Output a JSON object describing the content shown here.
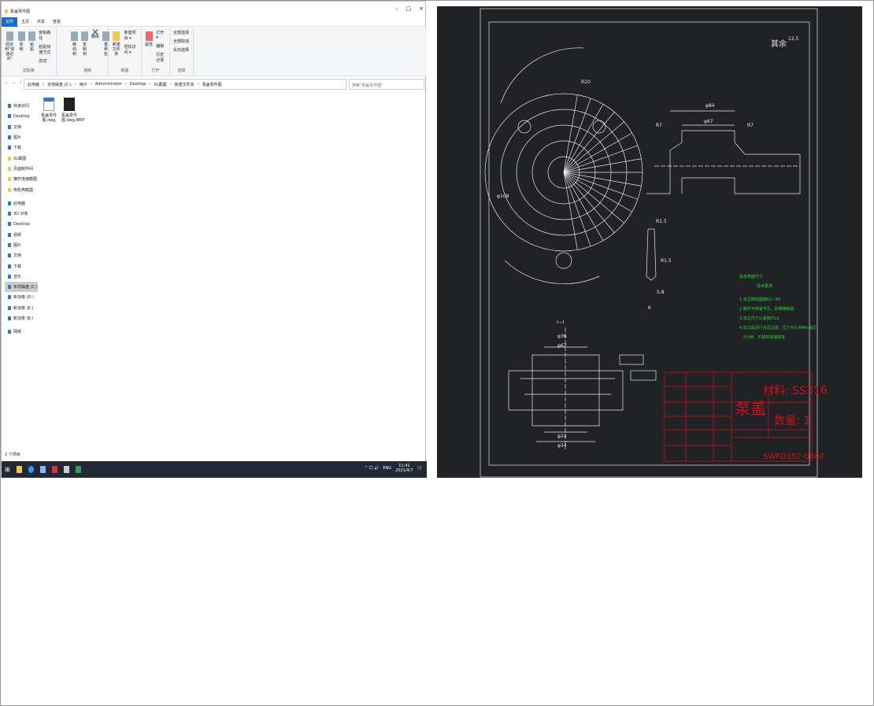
{
  "explorer": {
    "title": "泵盖零件图",
    "window_buttons": [
      "–",
      "□",
      "×"
    ],
    "tabs": [
      "文件",
      "主页",
      "共享",
      "查看"
    ],
    "ribbon": {
      "clipboard": {
        "name": "剪贴板",
        "pin": "固定到\"快速访问\"",
        "copy": "复制",
        "paste": "粘贴",
        "copy_path": "复制路径",
        "paste_shortcut": "粘贴快捷方式",
        "cut": "剪切"
      },
      "organize": {
        "name": "组织",
        "move_to": "移动到",
        "copy_to": "复制到",
        "delete": "删除",
        "rename": "重命名"
      },
      "new": {
        "name": "新建",
        "new_folder": "新建文件夹",
        "new_item": "新建项目 ▾",
        "easy_access": "轻松访问 ▾"
      },
      "open": {
        "name": "打开",
        "properties": "属性",
        "open": "打开 ▾",
        "edit": "编辑",
        "history": "历史记录"
      },
      "select": {
        "name": "选择",
        "select_all": "全部选择",
        "select_none": "全部取消",
        "invert": "反向选择"
      }
    },
    "breadcrumb": [
      "此电脑",
      "本地磁盘 (C:)",
      "用户",
      "Administrator",
      "Desktop",
      "XL截图",
      "新建文件夹",
      "泵盖零件图"
    ],
    "search_placeholder": "搜索\"泵盖零件图\"",
    "sidebar": [
      {
        "label": "快速访问",
        "icon": "star-icon",
        "sel": false
      },
      {
        "label": "Desktop",
        "icon": "desktop-icon",
        "sel": false
      },
      {
        "label": "文档",
        "icon": "document-icon",
        "sel": false
      },
      {
        "label": "图片",
        "icon": "picture-icon",
        "sel": false
      },
      {
        "label": "下载",
        "icon": "download-icon",
        "sel": false
      },
      {
        "label": "XL截图",
        "icon": "folder-icon",
        "sel": false
      },
      {
        "label": "页面制作间",
        "icon": "folder-icon",
        "sel": false
      },
      {
        "label": "横杆连接截图",
        "icon": "folder-icon",
        "sel": false
      },
      {
        "label": "电机壳截图",
        "icon": "folder-icon",
        "sel": false
      },
      {
        "label": "此电脑",
        "icon": "computer-icon",
        "sel": false
      },
      {
        "label": "3D 对象",
        "icon": "cube-icon",
        "sel": false
      },
      {
        "label": "Desktop",
        "icon": "desktop-icon",
        "sel": false
      },
      {
        "label": "视频",
        "icon": "video-icon",
        "sel": false
      },
      {
        "label": "图片",
        "icon": "picture-icon",
        "sel": false
      },
      {
        "label": "文档",
        "icon": "document-icon",
        "sel": false
      },
      {
        "label": "下载",
        "icon": "download-icon",
        "sel": false
      },
      {
        "label": "音乐",
        "icon": "music-icon",
        "sel": false
      },
      {
        "label": "本地磁盘 (C:)",
        "icon": "drive-icon",
        "sel": true
      },
      {
        "label": "新加卷 (D:)",
        "icon": "drive-icon",
        "sel": false
      },
      {
        "label": "新加卷 (E:)",
        "icon": "drive-icon",
        "sel": false
      },
      {
        "label": "新加卷 (E:)",
        "icon": "drive-icon",
        "sel": false
      },
      {
        "label": "网络",
        "icon": "network-icon",
        "sel": false
      }
    ],
    "files": [
      {
        "name": "泵盖零件图.dwg",
        "icon": "dwg-file-icon"
      },
      {
        "name": "泵盖零件图.dwg.BMP",
        "icon": "bmp-file-icon"
      }
    ],
    "status": "2 个项目",
    "taskbar": {
      "time": "11:41",
      "date": "2021/4/7",
      "lang": "ENG",
      "tray": "^ 🖵 🔊"
    }
  },
  "cad": {
    "colors": {
      "background": "#212226",
      "lines": "#e8e8e8",
      "titleblock": "#d0101a",
      "notes": "#22dd22"
    },
    "roughness": "其余",
    "roughness_value": "12.5",
    "dims": {
      "d84": "φ84",
      "d67": "φ67",
      "r7a": "R7",
      "r7b": "R7",
      "r15a": "R1.5",
      "r15b": "R1.5",
      "d58": "5.8",
      "k": "K",
      "sec": "I—I",
      "r20": "R20",
      "d108": "φ108",
      "d36": "φ36",
      "d67b": "φ67",
      "d24": "φ24",
      "d34": "φ34"
    },
    "notes": [
      "其余表面尺寸",
      "技术要求",
      "1.未注铸造圆角R2~R5",
      "2.铸件不得有气孔、砂眼等缺陷",
      "3.未注尺寸公差按IT12",
      "4.加工后进行水压试验，压力为0.6MPa保压",
      "5分钟，不得有渗漏现象"
    ],
    "titleblock": {
      "part": "泵盖",
      "material": "材料: SS316",
      "quantity": "数量: 1",
      "drawing_no": "SWFD152-0002"
    }
  }
}
